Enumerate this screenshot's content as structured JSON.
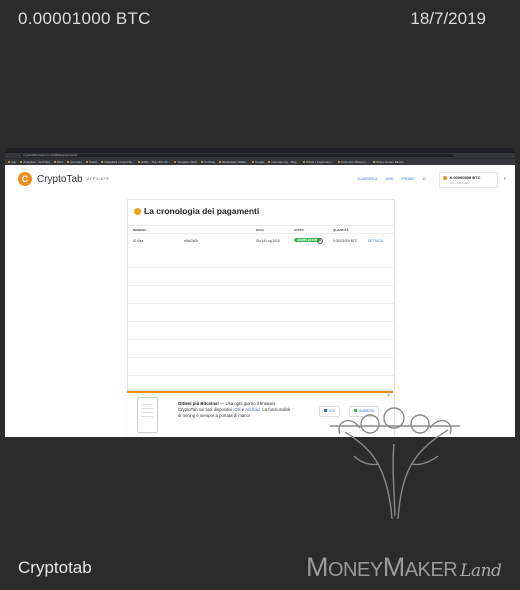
{
  "header": {
    "amount": "0.00001000 BTC",
    "date": "18/7/2019"
  },
  "footer": {
    "caption": "Cryptotab",
    "brand": {
      "m": "M",
      "oney": "ONEY",
      "m2": "M",
      "aker": "AKER",
      "land": "Land"
    }
  },
  "screenshot": {
    "url": "cryptotabbrowser.com/affiliate/payments/",
    "bookmarks": [
      "App",
      "Analytics - YouTube",
      "DOC",
      "Cerveau",
      "Twitch",
      "Classifica | CryptoTa...",
      "AdFly - The URL Sh...",
      "Telegram Web",
      "YouTube",
      "Blockchain Wallet -",
      "Google",
      "coinmap.org - Map...",
      "Whois | Crypto Env...",
      "Coinmoho Bitcoin |...",
      "Chat e Forum Bitcoin"
    ],
    "app": {
      "logo_letter": "C",
      "name": "CryptoTab",
      "badge": "AFFILIATE"
    },
    "nav": [
      "CLASSIFICA",
      "LINK",
      "PROMO",
      "IO"
    ],
    "balance": {
      "value": "0.00000509 BTC",
      "sub": "0 by 200 totale"
    },
    "page_title": "La cronologia dei pagamenti",
    "table": {
      "headers": [
        "MONEDO",
        "DATA",
        "STATO",
        "QUANTITÀ"
      ],
      "rows": [
        {
          "method": "ID Visa",
          "wallet": "wWd2aDt",
          "date": "Gio 18 Lug 2019",
          "status": "COMPLETATO",
          "amount": "0.00001000 BTC",
          "action": "DETTAGLI"
        }
      ]
    },
    "banner": {
      "title_bold": "Ottieni più Bitcoins!",
      "title_rest": " — Usa ogni giorno il browser",
      "line2_a": "CryptoTab sui tuoi dispositivi ",
      "ios_link": "iOS",
      "line2_b": " e ",
      "android_link": "Android",
      "line2_c": ". La funzionalità",
      "line3": "di mining è sempre a portata di mano!",
      "ios_button": "IOS",
      "android_button": "ANDROID",
      "close": "×"
    }
  },
  "colors": {
    "background": "#2b2b2b",
    "accent": "#f08e1c",
    "link": "#3b6bd6",
    "status": "#3dbb4a"
  }
}
